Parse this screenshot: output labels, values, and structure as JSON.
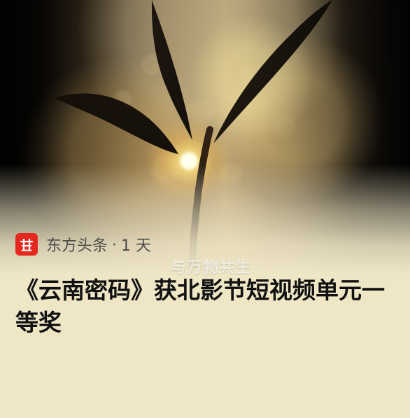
{
  "hero": {
    "overlay_text": "与万物共生"
  },
  "source": {
    "name": "东方头条",
    "separator": "·",
    "time": "1 天"
  },
  "headline": {
    "title": "《云南密码》获北影节短视频单元一等奖"
  },
  "icons": {
    "source_logo": "toutiao-logo-icon"
  },
  "colors": {
    "background": "#efe6c6",
    "logo_red": "#e5281f",
    "headline": "#111111",
    "source_text": "#4b4b4b"
  }
}
